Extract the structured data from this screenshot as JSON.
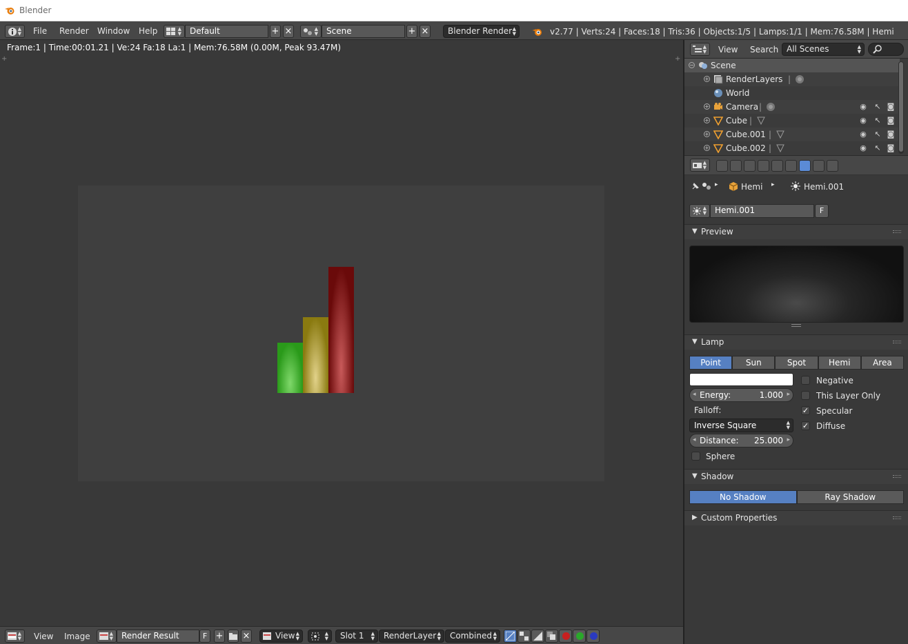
{
  "window": {
    "title": "Blender"
  },
  "info_header": {
    "menus": [
      "File",
      "Render",
      "Window",
      "Help"
    ],
    "layout": "Default",
    "scene": "Scene",
    "engine": "Blender Render",
    "stats": "v2.77 | Verts:24 | Faces:18 | Tris:36 | Objects:1/5 | Lamps:1/1 | Mem:76.58M | Hemi"
  },
  "image_editor": {
    "status": "Frame:1 | Time:00:01.21 | Ve:24 Fa:18 La:1 | Mem:76.58M (0.00M, Peak 93.47M)",
    "bars": [
      {
        "color_top": "#2a9a1a",
        "color_mid": "#7fd86a",
        "level": 0.4
      },
      {
        "color_top": "#8a7a10",
        "color_mid": "#e2d28a",
        "level": 0.6
      },
      {
        "color_top": "#6a0a0a",
        "color_mid": "#c85a5a",
        "level": 1.0
      }
    ]
  },
  "bottom_header": {
    "menus": [
      "View",
      "Image"
    ],
    "image_name": "Render Result",
    "fake_user": "F",
    "view_menu": "View",
    "slot": "Slot 1",
    "layer": "RenderLayer",
    "pass": "Combined"
  },
  "outliner": {
    "menus": [
      "View",
      "Search"
    ],
    "filter": "All Scenes",
    "rows": [
      {
        "label": "Scene",
        "icon": "scene-icon"
      },
      {
        "label": "RenderLayers",
        "icon": "render-layers-icon"
      },
      {
        "label": "World",
        "icon": "world-icon"
      },
      {
        "label": "Camera",
        "icon": "camera-icon"
      },
      {
        "label": "Cube",
        "icon": "mesh-icon"
      },
      {
        "label": "Cube.001",
        "icon": "mesh-icon"
      },
      {
        "label": "Cube.002",
        "icon": "mesh-icon"
      }
    ]
  },
  "properties": {
    "breadcrumb": {
      "object": "Hemi",
      "data": "Hemi.001"
    },
    "datablock": {
      "name": "Hemi.001",
      "fake_user": "F"
    },
    "panels": {
      "preview": "Preview",
      "lamp": "Lamp",
      "shadow": "Shadow",
      "custom": "Custom Properties"
    },
    "lamp_types": [
      "Point",
      "Sun",
      "Spot",
      "Hemi",
      "Area"
    ],
    "lamp_active": "Point",
    "lamp_color": "#ffffff",
    "energy": {
      "label": "Energy:",
      "value": "1.000"
    },
    "falloff_label": "Falloff:",
    "falloff": "Inverse Square",
    "distance": {
      "label": "Distance:",
      "value": "25.000"
    },
    "checks": {
      "negative": {
        "label": "Negative",
        "checked": false
      },
      "this_layer_only": {
        "label": "This Layer Only",
        "checked": false
      },
      "specular": {
        "label": "Specular",
        "checked": true
      },
      "diffuse": {
        "label": "Diffuse",
        "checked": true
      },
      "sphere": {
        "label": "Sphere",
        "checked": false
      }
    },
    "shadow_types": [
      "No Shadow",
      "Ray Shadow"
    ],
    "shadow_active": "No Shadow"
  }
}
